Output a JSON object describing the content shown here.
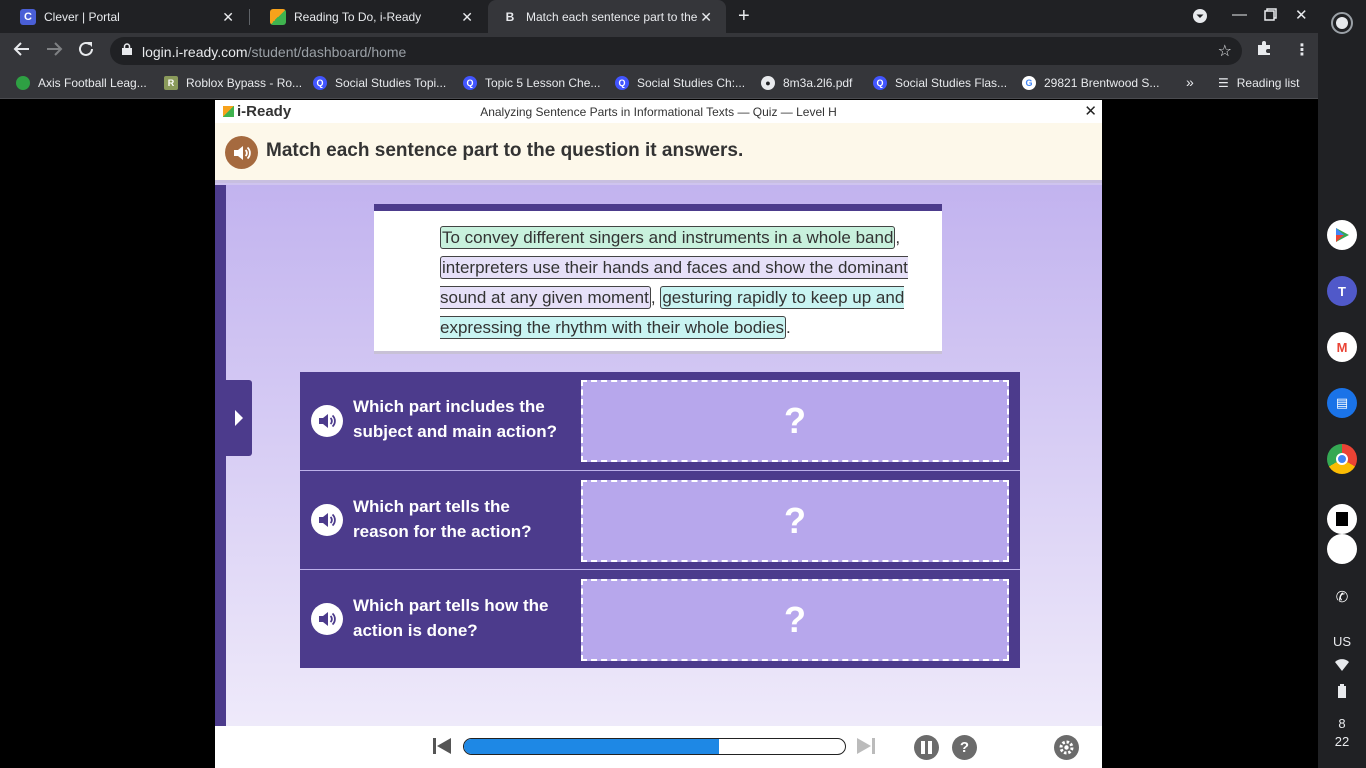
{
  "browser": {
    "tabs": [
      {
        "title": "Clever | Portal",
        "favicon": "clever-icon",
        "active": false
      },
      {
        "title": "Reading To Do, i-Ready",
        "favicon": "iready-icon",
        "active": false
      },
      {
        "title": "Match each sentence part to the",
        "favicon": "brainly-icon",
        "active": true
      }
    ],
    "url_host": "login.i-ready.com",
    "url_path": "/student/dashboard/home",
    "bookmarks": [
      "Axis Football Leag...",
      "Roblox Bypass - Ro...",
      "Social Studies Topi...",
      "Topic 5 Lesson Che...",
      "Social Studies Ch:...",
      "8m3a.2l6.pdf",
      "Social Studies Flas...",
      "29821 Brentwood S..."
    ],
    "reading_list": "Reading list"
  },
  "shelf": {
    "locale": "US",
    "time_hour": "8",
    "time_min": "22"
  },
  "app": {
    "logo": "i-Ready",
    "lesson_title": "Analyzing Sentence Parts in Informational Texts — Quiz — Level H",
    "instruction": "Match each sentence part to the question it answers.",
    "passage": {
      "part_a": "To convey different singers and instruments in a whole band",
      "sep_1": ",",
      "part_b": "interpreters use their hands and faces and show the dominant sound at any given moment",
      "sep_2": ",",
      "part_c": "gesturing rapidly to keep up and expressing the rhythm with their whole bodies",
      "end": "."
    },
    "questions": [
      {
        "text": "Which part includes the subject and main action?",
        "answer": "?"
      },
      {
        "text": "Which part tells the reason for the action?",
        "answer": "?"
      },
      {
        "text": "Which part tells how the action is done?",
        "answer": "?"
      }
    ],
    "progress": 0.67,
    "help_label": "?"
  },
  "colors": {
    "brand_purple": "#4c3b8c",
    "drop_zone": "#b7a7ec",
    "progress_blue": "#1e88e5"
  }
}
